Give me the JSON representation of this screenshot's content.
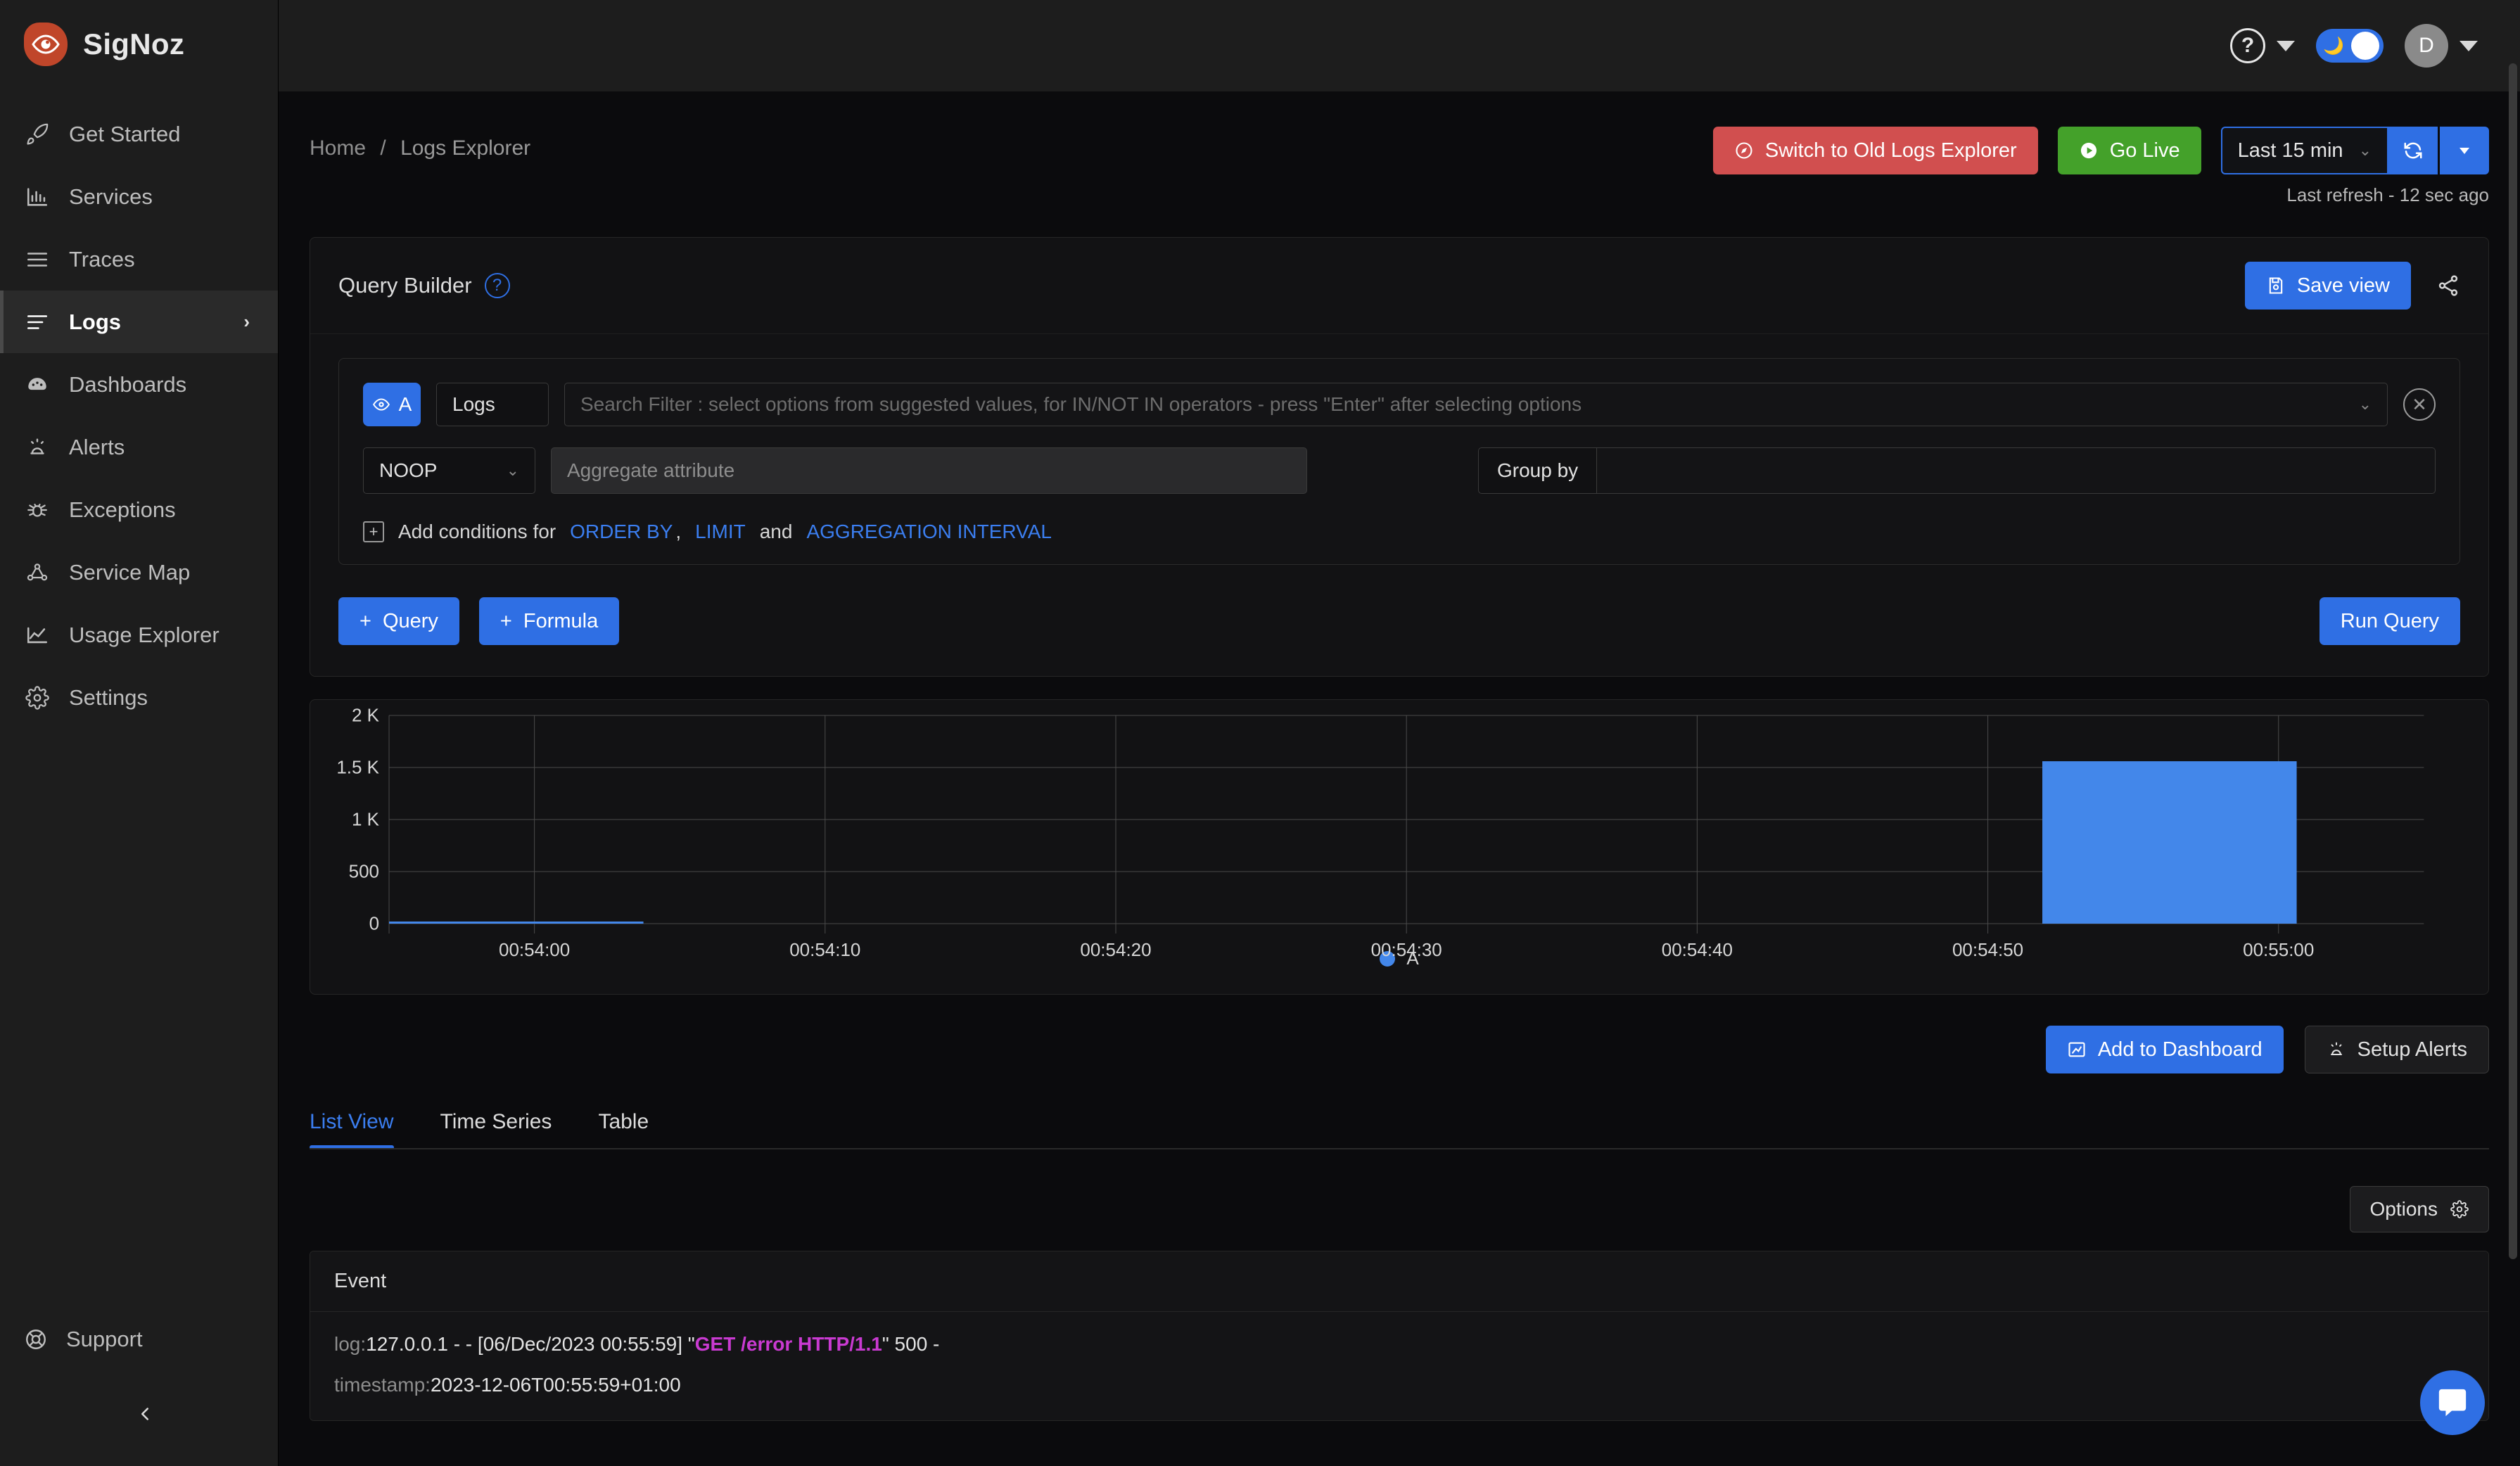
{
  "brand": {
    "name": "SigNoz"
  },
  "sidebar": {
    "items": [
      {
        "label": "Get Started",
        "icon": "rocket-icon",
        "active": false
      },
      {
        "label": "Services",
        "icon": "bar-chart-icon",
        "active": false
      },
      {
        "label": "Traces",
        "icon": "menu-lines-icon",
        "active": false
      },
      {
        "label": "Logs",
        "icon": "logs-lines-icon",
        "active": true,
        "chevron": "›"
      },
      {
        "label": "Dashboards",
        "icon": "dashboard-icon",
        "active": false
      },
      {
        "label": "Alerts",
        "icon": "alert-siren-icon",
        "active": false
      },
      {
        "label": "Exceptions",
        "icon": "bug-icon",
        "active": false
      },
      {
        "label": "Service Map",
        "icon": "service-map-icon",
        "active": false
      },
      {
        "label": "Usage Explorer",
        "icon": "line-chart-icon",
        "active": false
      },
      {
        "label": "Settings",
        "icon": "gear-icon",
        "active": false
      }
    ],
    "support_label": "Support",
    "collapse_icon": "chevron-left-icon"
  },
  "topbar": {
    "help_icon": "question-mark-icon",
    "theme_toggle": {
      "icon": "moon-icon",
      "on": true
    },
    "avatar_initial": "D"
  },
  "breadcrumb": {
    "home": "Home",
    "separator": "/",
    "current": "Logs Explorer"
  },
  "header_actions": {
    "switch_old_label": "Switch to Old Logs Explorer",
    "go_live_label": "Go Live",
    "time_range": "Last 15 min",
    "refresh_icon": "refresh-icon",
    "dropdown_icon": "caret-down-icon",
    "last_refresh": "Last refresh - 12 sec ago"
  },
  "query_builder": {
    "title": "Query Builder",
    "help_icon": "question-mark-icon",
    "save_view_label": "Save view",
    "share_icon": "share-icon",
    "query_badge": {
      "letter": "A",
      "icon": "eye-icon"
    },
    "source": "Logs",
    "search_placeholder": "Search Filter : select options from suggested values, for IN/NOT IN operators - press \"Enter\" after selecting options",
    "clear_icon": "close-circle-icon",
    "aggregate_operator": "NOOP",
    "aggregate_attribute_placeholder": "Aggregate attribute",
    "group_by_label": "Group by",
    "group_by_value": "",
    "add_conditions": {
      "prefix": "Add conditions for",
      "link_order_by": "ORDER BY",
      "comma": ",",
      "link_limit": "LIMIT",
      "and": "and",
      "link_agg_interval": "AGGREGATION INTERVAL"
    },
    "add_query_label": "Query",
    "add_formula_label": "Formula",
    "run_query_label": "Run Query"
  },
  "chart_data": {
    "type": "bar",
    "title": "",
    "xlabel": "",
    "ylabel": "",
    "ylim": [
      0,
      2000
    ],
    "ytick_labels": [
      "0",
      "500",
      "1 K",
      "1.5 K",
      "2 K"
    ],
    "ytick_values": [
      0,
      500,
      1000,
      1500,
      2000
    ],
    "xtick_labels": [
      "00:54:00",
      "00:54:10",
      "00:54:20",
      "00:54:30",
      "00:54:40",
      "00:54:50",
      "00:55:00"
    ],
    "grid": true,
    "legend": [
      {
        "name": "A",
        "color": "#4387ea"
      }
    ],
    "series": [
      {
        "name": "A",
        "color": "#4387ea",
        "x": [
          "00:53:55",
          "00:55:00"
        ],
        "values": [
          12,
          1560
        ]
      }
    ]
  },
  "dashboard_actions": {
    "add_to_dashboard_label": "Add to Dashboard",
    "setup_alerts_label": "Setup Alerts"
  },
  "tabs": [
    {
      "label": "List View",
      "active": true
    },
    {
      "label": "Time Series",
      "active": false
    },
    {
      "label": "Table",
      "active": false
    }
  ],
  "options": {
    "label": "Options",
    "icon": "gear-icon"
  },
  "log_table": {
    "column_header": "Event",
    "rows": [
      {
        "log_key": "log:",
        "log_pre": "127.0.0.1 - - [06/Dec/2023 00:55:59] \"",
        "log_highlight": "GET /error HTTP/1.1",
        "log_post": "\" 500 -",
        "timestamp_key": "timestamp:",
        "timestamp_value": "2023-12-06T00:55:59+01:00"
      }
    ]
  },
  "intercom": {
    "icon": "chat-bubble-icon"
  }
}
